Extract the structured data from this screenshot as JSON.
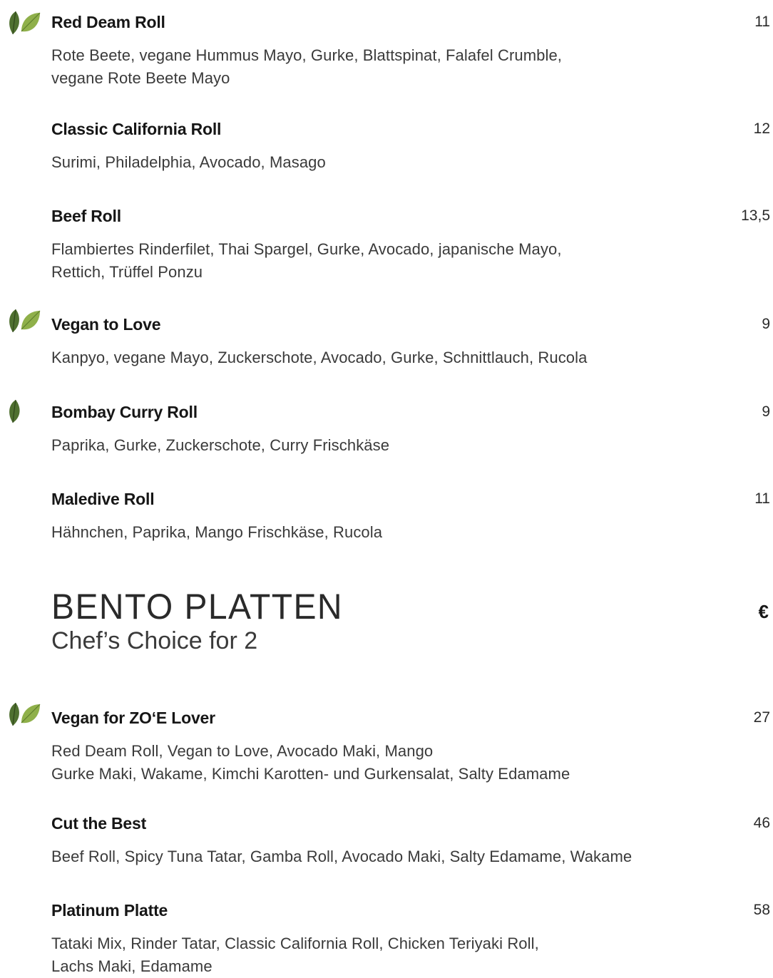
{
  "colors": {
    "leaf_dark": "#3d5a2a",
    "leaf_mid": "#6e8f3c",
    "leaf_light": "#a8c46a",
    "text": "#1a1a1a"
  },
  "rolls": [
    {
      "name": "Red Deam Roll",
      "price": "11",
      "icon": "double-leaf-icon",
      "desc": [
        "Rote Beete, vegane Hummus Mayo, Gurke, Blattspinat, Falafel Crumble,",
        "vegane Rote Beete Mayo"
      ]
    },
    {
      "name": "Classic California Roll",
      "price": "12",
      "icon": "",
      "desc": [
        "Surimi, Philadelphia, Avocado, Masago"
      ]
    },
    {
      "name": "Beef Roll",
      "price": "13,5",
      "icon": "",
      "desc": [
        "Flambiertes Rinderfilet, Thai Spargel, Gurke, Avocado, japanische Mayo,",
        "Rettich, Trüffel Ponzu"
      ]
    },
    {
      "name": "Vegan to Love",
      "price": "9",
      "icon": "double-leaf-icon",
      "desc": [
        "Kanpyo, vegane Mayo, Zuckerschote, Avocado, Gurke, Schnittlauch, Rucola"
      ]
    },
    {
      "name": "Bombay Curry Roll",
      "price": "9",
      "icon": "single-leaf-icon",
      "desc": [
        "Paprika, Gurke, Zuckerschote, Curry Frischkäse"
      ]
    },
    {
      "name": "Maledive Roll",
      "price": "11",
      "icon": "",
      "desc": [
        "Hähnchen, Paprika, Mango Frischkäse, Rucola"
      ]
    }
  ],
  "section": {
    "title": "BENTO PLATTEN",
    "subtitle": "Chef’s Choice for 2",
    "currency": "€"
  },
  "platters": [
    {
      "name": "Vegan for ZO‘E Lover",
      "price": "27",
      "icon": "double-leaf-icon",
      "desc": [
        "Red Deam Roll, Vegan to Love, Avocado Maki, Mango",
        "Gurke Maki, Wakame, Kimchi Karotten- und Gurkensalat, Salty Edamame"
      ]
    },
    {
      "name": "Cut the Best",
      "price": "46",
      "icon": "",
      "desc": [
        "Beef Roll, Spicy Tuna Tatar, Gamba Roll, Avocado Maki, Salty Edamame, Wakame"
      ]
    },
    {
      "name": "Platinum Platte",
      "price": "58",
      "icon": "",
      "desc": [
        "Tataki Mix, Rinder Tatar, Classic California Roll, Chicken Teriyaki Roll,",
        "Lachs Maki, Edamame"
      ]
    }
  ]
}
